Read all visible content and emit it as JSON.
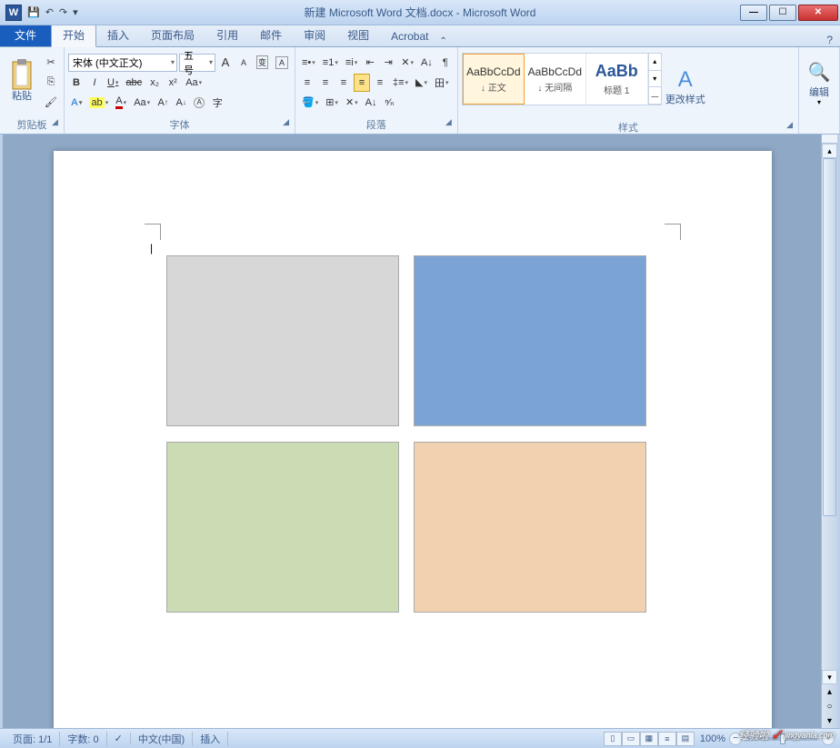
{
  "title": "新建 Microsoft Word 文档.docx - Microsoft Word",
  "qat": {
    "save": "💾",
    "undo": "↶",
    "redo": "↷",
    "more": "▾"
  },
  "tabs": {
    "file": "文件",
    "home": "开始",
    "insert": "插入",
    "layout": "页面布局",
    "ref": "引用",
    "mail": "邮件",
    "review": "审阅",
    "view": "视图",
    "acrobat": "Acrobat"
  },
  "ribbon": {
    "clipboard": {
      "paste": "粘贴",
      "label": "剪贴板"
    },
    "font": {
      "name": "宋体 (中文正文)",
      "size": "五号",
      "label": "字体",
      "bold": "B",
      "italic": "I",
      "underline": "U",
      "strike": "abc",
      "sub": "x₂",
      "sup": "x²",
      "grow": "A",
      "shrink": "A",
      "clear": "Aa",
      "effects": "A",
      "highlight": "A",
      "color": "A",
      "case": "Aa",
      "phonetic": "拼",
      "charborder": "A",
      "circled": "㊕"
    },
    "paragraph": {
      "label": "段落",
      "bullets": "•",
      "numbers": "1.",
      "multilevel": "i.",
      "dedent": "⇤",
      "indent": "⇥",
      "sort": "A↓",
      "showmarks": "¶",
      "left": "≡",
      "center": "≡",
      "right": "≡",
      "justify": "≡",
      "dist": "≡",
      "linespace": "↕",
      "shading": "◣",
      "borders": "田"
    },
    "styles": {
      "label": "样式",
      "items": [
        {
          "preview": "AaBbCcDd",
          "name": "↓ 正文"
        },
        {
          "preview": "AaBbCcDd",
          "name": "↓ 无间隔"
        },
        {
          "preview": "AaBb",
          "name": "标题 1"
        }
      ],
      "change": "更改样式"
    },
    "editing": {
      "label": "编辑",
      "find": "编辑"
    }
  },
  "status": {
    "page": "页面: 1/1",
    "words": "字数: 0",
    "lang": "中文(中国)",
    "mode": "插入",
    "zoom": "100%"
  },
  "shapes": {
    "s1_color": "#d7d7d7",
    "s2_color": "#7ba3d4",
    "s3_color": "#cbdcb5",
    "s4_color": "#f2d1b0"
  },
  "watermark": {
    "text": "经验啦",
    "url": "jingyanla.com"
  }
}
